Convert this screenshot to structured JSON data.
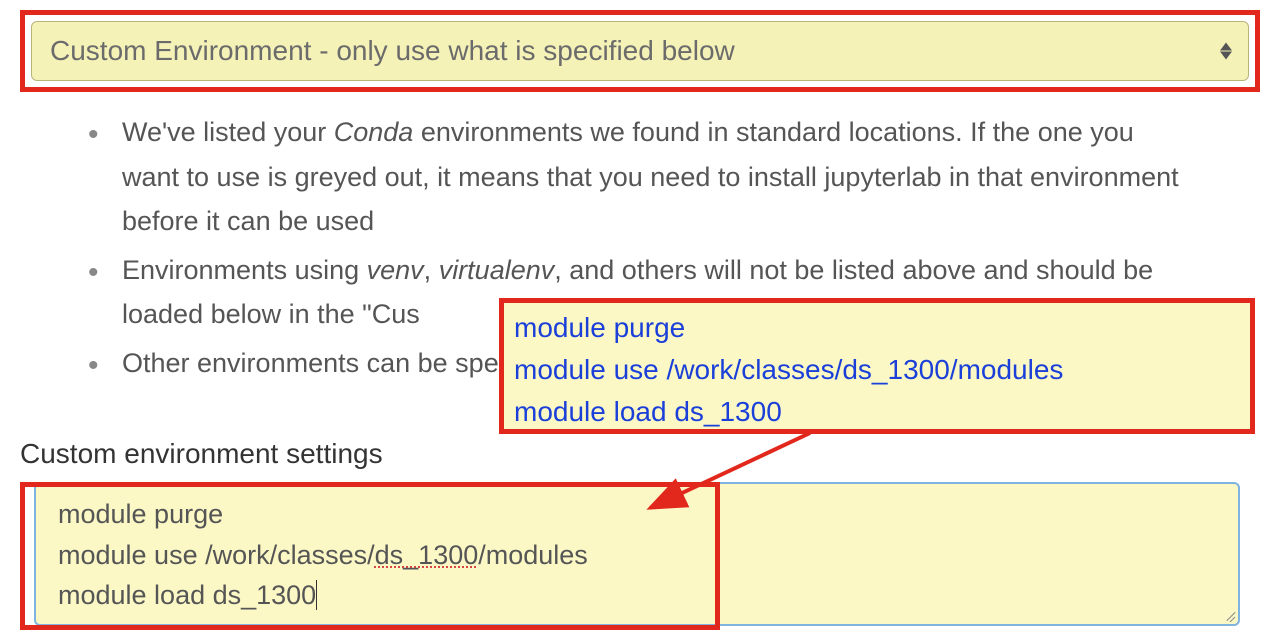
{
  "dropdown": {
    "selected": "Custom Environment - only use what is specified below"
  },
  "bullets": {
    "item1_part1": "We've listed your ",
    "item1_conda": "Conda",
    "item1_part2": " environments we found in standard locations. If the one you want to use is greyed out, it means that you need to install jupyterlab in that environment before it can be used",
    "item2_part1": "Environments using ",
    "item2_venv": "venv",
    "item2_comma": ", ",
    "item2_virtualenv": "virtualenv",
    "item2_part2": ", and others will not be listed above and should be loaded below in the \"Cus",
    "item3": "Other environments can be specifie"
  },
  "callout": {
    "line1": "module purge",
    "line2": "module use /work/classes/ds_1300/modules",
    "line3": "module load ds_1300"
  },
  "section_label": "Custom environment settings",
  "textarea": {
    "line1": "module purge",
    "line2_a": "module use /work/classes/",
    "line2_b": "ds_1300",
    "line2_c": "/modules",
    "line3": "module load ds_1300"
  }
}
